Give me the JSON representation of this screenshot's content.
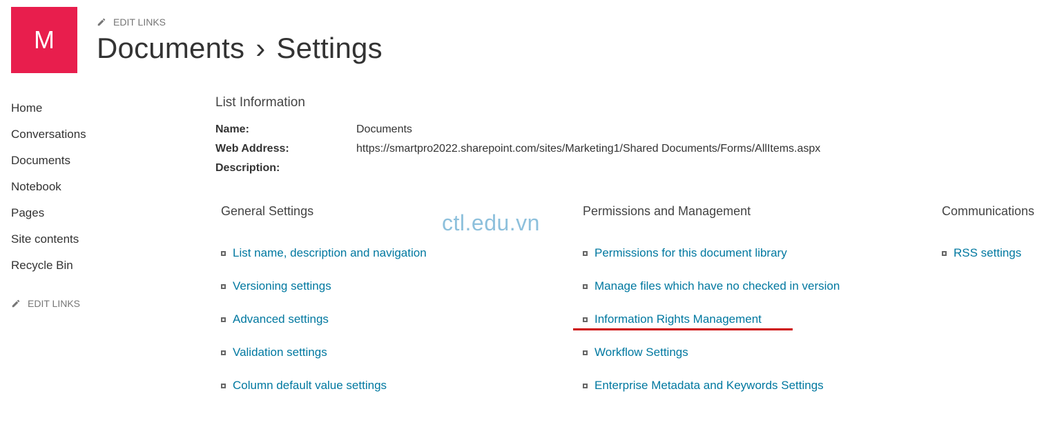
{
  "siteLogoLetter": "M",
  "editLinksLabel": "EDIT LINKS",
  "breadcrumb": {
    "first": "Documents",
    "separator": "›",
    "second": "Settings"
  },
  "leftNav": [
    "Home",
    "Conversations",
    "Documents",
    "Notebook",
    "Pages",
    "Site contents",
    "Recycle Bin"
  ],
  "listInfo": {
    "heading": "List Information",
    "nameLabel": "Name:",
    "nameValue": "Documents",
    "webAddressLabel": "Web Address:",
    "webAddressValue": "https://smartpro2022.sharepoint.com/sites/Marketing1/Shared Documents/Forms/AllItems.aspx",
    "descriptionLabel": "Description:",
    "descriptionValue": ""
  },
  "columns": {
    "general": {
      "heading": "General Settings",
      "links": [
        "List name, description and navigation",
        "Versioning settings",
        "Advanced settings",
        "Validation settings",
        "Column default value settings"
      ]
    },
    "permissions": {
      "heading": "Permissions and Management",
      "links": [
        "Permissions for this document library",
        "Manage files which have no checked in version",
        "Information Rights Management",
        "Workflow Settings",
        "Enterprise Metadata and Keywords Settings"
      ]
    },
    "communications": {
      "heading": "Communications",
      "links": [
        "RSS settings"
      ]
    }
  },
  "watermark": "ctl.edu.vn"
}
